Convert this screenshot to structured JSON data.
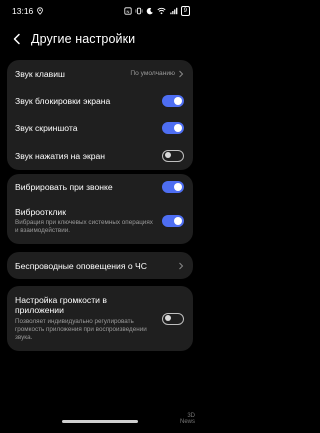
{
  "status": {
    "time": "13:16",
    "battery": "9"
  },
  "header": {
    "title": "Другие настройки"
  },
  "group1": {
    "key_sound": {
      "label": "Звук клавиш",
      "value": "По умолчанию"
    },
    "lock_sound": {
      "label": "Звук блокировки экрана",
      "state": "on"
    },
    "screenshot_sound": {
      "label": "Звук скриншота",
      "state": "on"
    },
    "touch_sound": {
      "label": "Звук нажатия на экран",
      "state": "off"
    }
  },
  "group2": {
    "vibrate_ring": {
      "label": "Вибрировать при звонке",
      "state": "on"
    },
    "haptic": {
      "label": "Виброотклик",
      "sub": "Вибрация при ключевых системных операциях и взаимодействии.",
      "state": "on"
    }
  },
  "group3": {
    "emergency": {
      "label": "Беспроводные оповещения о ЧС"
    }
  },
  "group4": {
    "app_volume": {
      "label": "Настройка громкости в приложении",
      "sub": "Позволяет индивидуально регулировать громкость приложения при воспроизведении звука.",
      "state": "off"
    }
  },
  "watermark": {
    "line1": "3D",
    "line2": "News"
  },
  "colors": {
    "accent": "#4e6ef2",
    "card": "#1f1f1f",
    "background": "#000000"
  }
}
